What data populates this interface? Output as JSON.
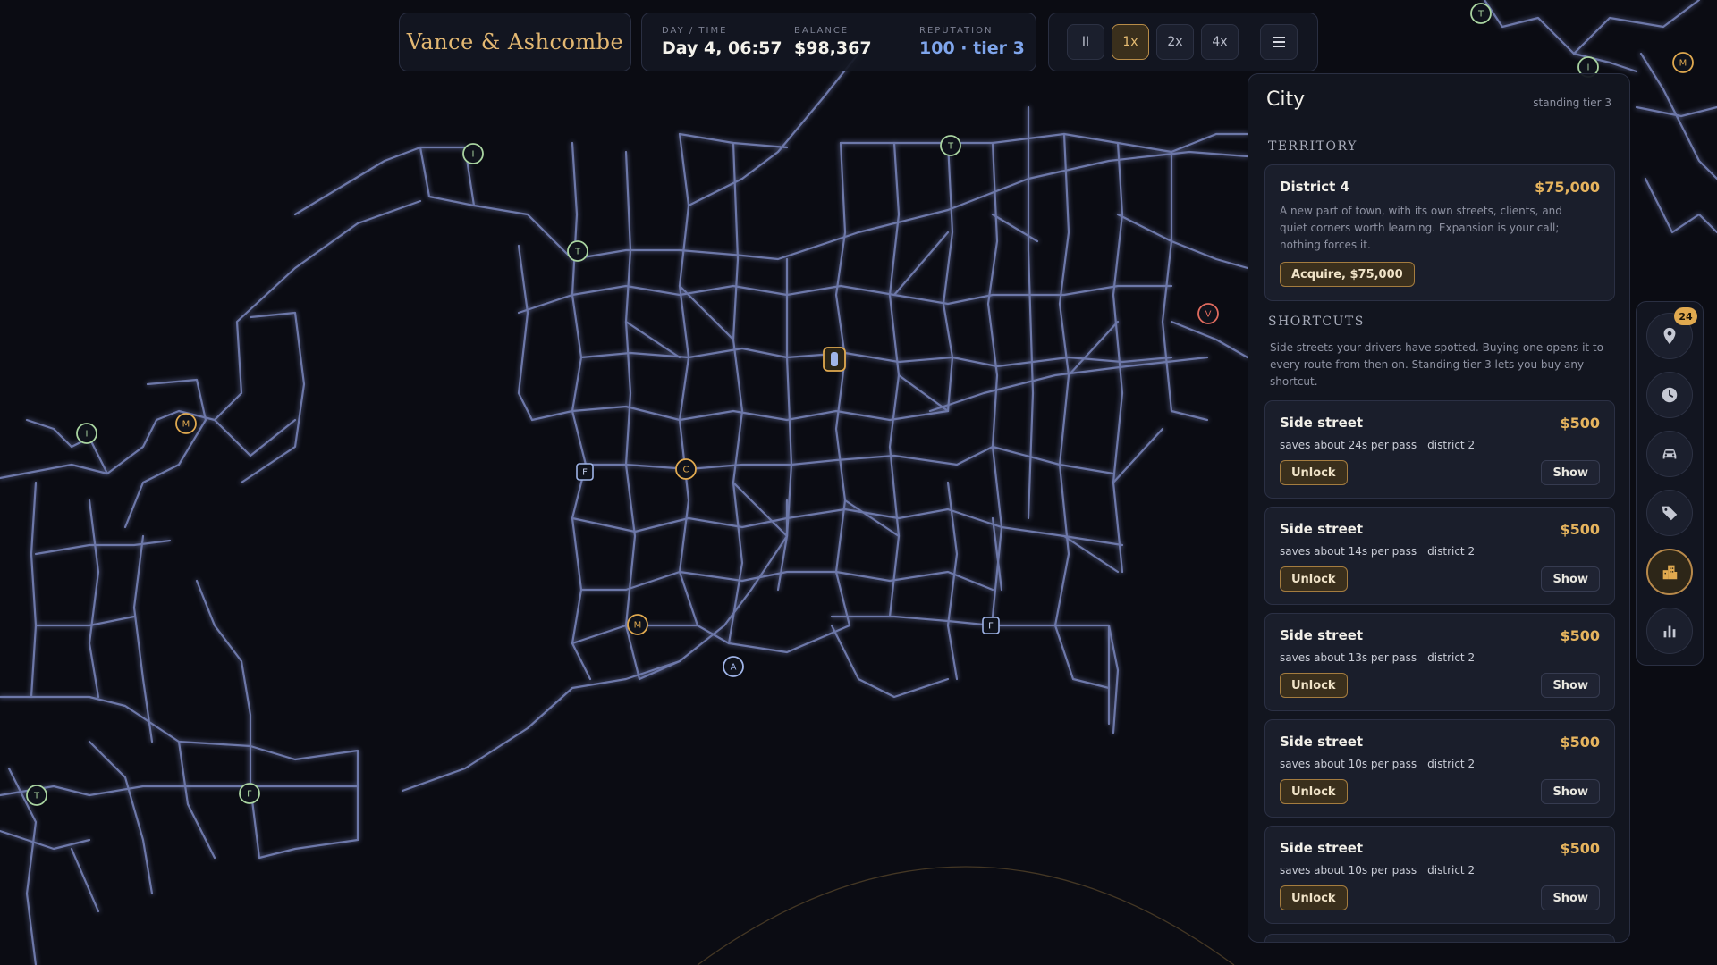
{
  "hud": {
    "brand": "Vance & Ashcombe",
    "day_label": "DAY / TIME",
    "day_value": "Day 4, 06:57",
    "balance_label": "BALANCE",
    "balance_value": "$98,367",
    "rep_label": "REPUTATION",
    "rep_value": "100 · tier 3",
    "speed": [
      "II",
      "1x",
      "2x",
      "4x"
    ],
    "active_speed": "1x",
    "menu_icon": "menu-icon"
  },
  "panel": {
    "title": "City",
    "subtitle": "standing tier 3",
    "territory": {
      "heading": "TERRITORY",
      "card": {
        "title": "District 4",
        "price": "$75,000",
        "desc": "A new part of town, with its own streets, clients, and quiet corners worth learning. Expansion is your call; nothing forces it.",
        "action": "Acquire, $75,000"
      }
    },
    "shortcuts": {
      "heading": "SHORTCUTS",
      "desc": "Side streets your drivers have spotted. Buying one opens it to every route from then on. Standing tier 3 lets you buy any shortcut.",
      "items": [
        {
          "title": "Side street",
          "price": "$500",
          "saves": "saves about 24s per pass",
          "district": "district 2",
          "unlock": "Unlock",
          "show": "Show"
        },
        {
          "title": "Side street",
          "price": "$500",
          "saves": "saves about 14s per pass",
          "district": "district 2",
          "unlock": "Unlock",
          "show": "Show"
        },
        {
          "title": "Side street",
          "price": "$500",
          "saves": "saves about 13s per pass",
          "district": "district 2",
          "unlock": "Unlock",
          "show": "Show"
        },
        {
          "title": "Side street",
          "price": "$500",
          "saves": "saves about 10s per pass",
          "district": "district 2",
          "unlock": "Unlock",
          "show": "Show"
        },
        {
          "title": "Side street",
          "price": "$500",
          "saves": "saves about 10s per pass",
          "district": "district 2",
          "unlock": "Unlock",
          "show": "Show"
        }
      ]
    }
  },
  "rail": {
    "items": [
      {
        "icon": "map-pin-icon",
        "badge": "24"
      },
      {
        "icon": "clock-icon"
      },
      {
        "icon": "car-icon"
      },
      {
        "icon": "tag-icon"
      },
      {
        "icon": "city-icon",
        "active": true
      },
      {
        "icon": "bar-chart-icon"
      }
    ]
  },
  "map": {
    "markers": [
      {
        "letter": "I",
        "color": "#a9d4a0"
      },
      {
        "letter": "T",
        "color": "#a9d4a0"
      },
      {
        "letter": "T",
        "color": "#a9d4a0"
      },
      {
        "letter": "I",
        "color": "#a9d4a0"
      },
      {
        "letter": "M",
        "color": "#e0a94f"
      },
      {
        "letter": "C",
        "color": "#e0a94f"
      },
      {
        "letter": "M",
        "color": "#e0a94f"
      },
      {
        "letter": "A",
        "color": "#9fb4e8"
      },
      {
        "letter": "T",
        "color": "#a9d4a0"
      },
      {
        "letter": "F",
        "color": "#a9d4a0"
      },
      {
        "letter": "V",
        "color": "#e06b5e"
      },
      {
        "letter": "T",
        "color": "#a9d4a0"
      },
      {
        "letter": "I",
        "color": "#a9d4a0"
      },
      {
        "letter": "M",
        "color": "#e0a94f"
      }
    ],
    "depots": [
      {
        "letter": "F"
      },
      {
        "letter": "F"
      }
    ],
    "road_color": "#7f8bc4",
    "background": "#0b0c13"
  }
}
